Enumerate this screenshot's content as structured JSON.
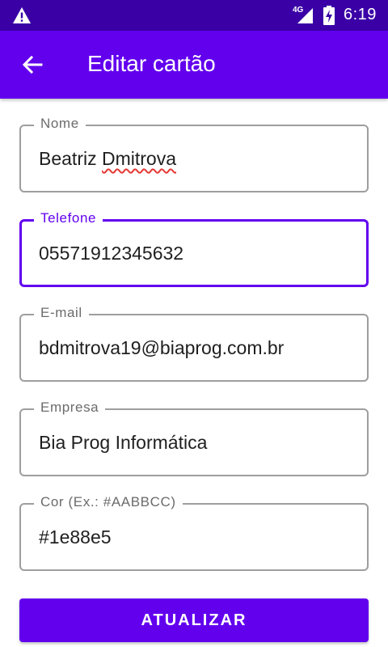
{
  "status_bar": {
    "network_label": "4G",
    "time": "6:19"
  },
  "app_bar": {
    "title": "Editar cartão"
  },
  "form": {
    "nome": {
      "label": "Nome",
      "value_first": "Beatriz",
      "value_second": "Dmitrova"
    },
    "telefone": {
      "label": "Telefone",
      "value": "05571912345632"
    },
    "email": {
      "label": "E-mail",
      "value": "bdmitrova19@biaprog.com.br"
    },
    "empresa": {
      "label": "Empresa",
      "value": "Bia Prog Informática"
    },
    "cor": {
      "label": "Cor (Ex.: #AABBCC)",
      "value": "#1e88e5"
    }
  },
  "actions": {
    "update_label": "ATUALIZAR"
  },
  "colors": {
    "primary": "#6200ee",
    "primary_dark": "#3a00a6",
    "outline": "#9e9e9e",
    "spellcheck": "#e53935"
  }
}
